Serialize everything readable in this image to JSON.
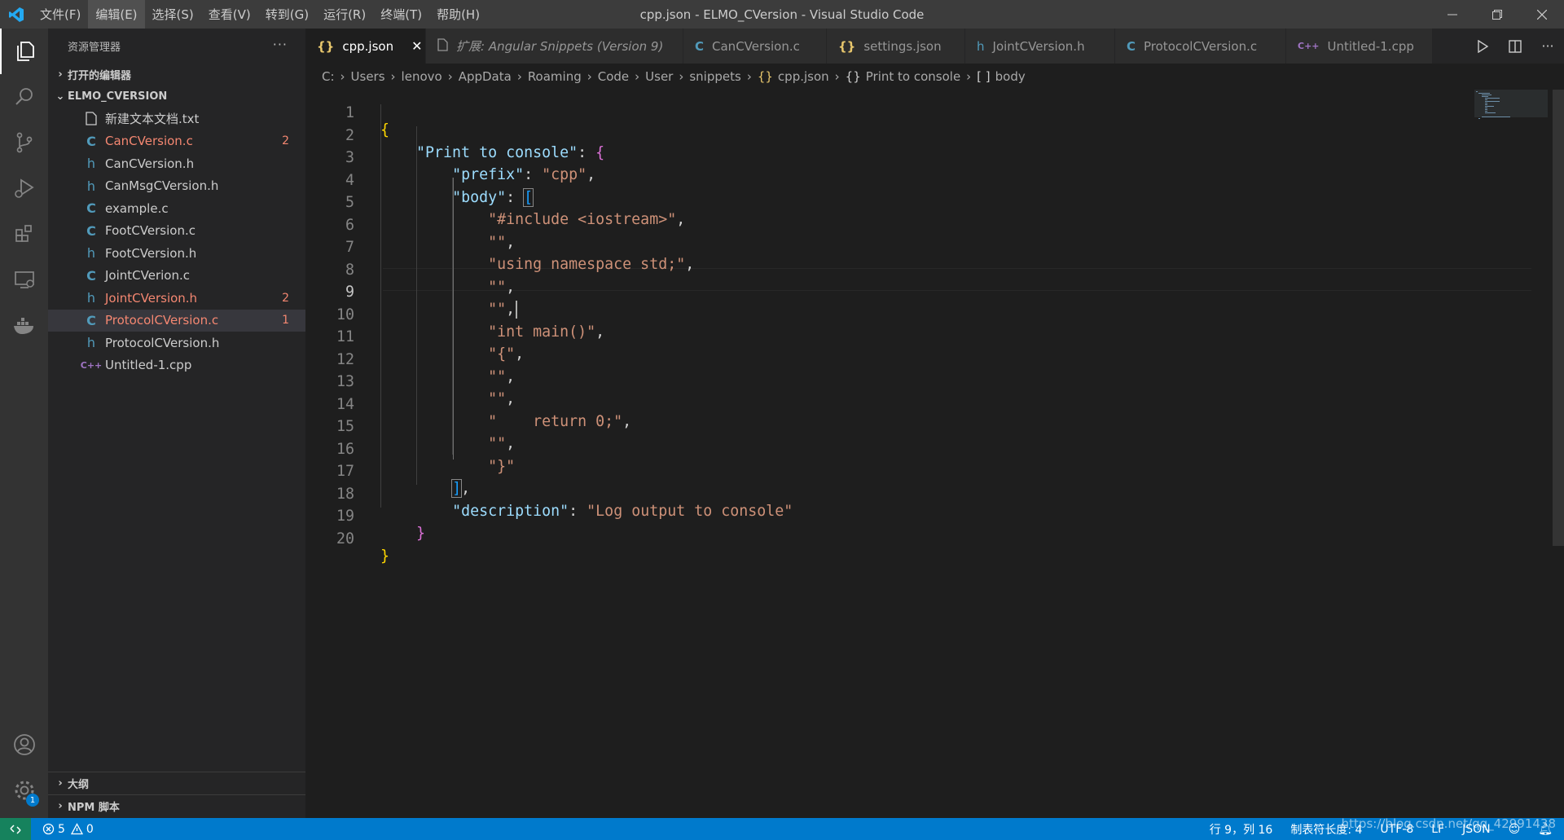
{
  "window": {
    "title": "cpp.json - ELMO_CVersion - Visual Studio Code",
    "menu": [
      "文件(F)",
      "编辑(E)",
      "选择(S)",
      "查看(V)",
      "转到(G)",
      "运行(R)",
      "终端(T)",
      "帮助(H)"
    ]
  },
  "sidebar": {
    "title": "资源管理器",
    "open_editors": "打开的编辑器",
    "folder": "ELMO_CVERSION",
    "files": [
      {
        "name": "新建文本文档.txt",
        "icon": "txt",
        "count": ""
      },
      {
        "name": "CanCVersion.c",
        "icon": "C",
        "count": "2"
      },
      {
        "name": "CanCVersion.h",
        "icon": "h",
        "count": ""
      },
      {
        "name": "CanMsgCVersion.h",
        "icon": "h",
        "count": ""
      },
      {
        "name": "example.c",
        "icon": "C",
        "count": ""
      },
      {
        "name": "FootCVersion.c",
        "icon": "C",
        "count": ""
      },
      {
        "name": "FootCVersion.h",
        "icon": "h",
        "count": ""
      },
      {
        "name": "JointCVerion.c",
        "icon": "C",
        "count": ""
      },
      {
        "name": "JointCVersion.h",
        "icon": "h",
        "count": "2"
      },
      {
        "name": "ProtocolCVersion.c",
        "icon": "C",
        "count": "1"
      },
      {
        "name": "ProtocolCVersion.h",
        "icon": "h",
        "count": ""
      },
      {
        "name": "Untitled-1.cpp",
        "icon": "C++",
        "count": ""
      }
    ],
    "outline": "大纲",
    "npm": "NPM 脚本"
  },
  "tabs": [
    {
      "icon": "{}",
      "label": "cpp.json"
    },
    {
      "icon": "doc",
      "label": "扩展: Angular Snippets (Version 9)"
    },
    {
      "icon": "C",
      "label": "CanCVersion.c"
    },
    {
      "icon": "{}",
      "label": "settings.json"
    },
    {
      "icon": "h",
      "label": "JointCVersion.h"
    },
    {
      "icon": "C",
      "label": "ProtocolCVersion.c"
    },
    {
      "icon": "C++",
      "label": "Untitled-1.cpp"
    }
  ],
  "breadcrumb": {
    "path": [
      "C:",
      "Users",
      "lenovo",
      "AppData",
      "Roaming",
      "Code",
      "User",
      "snippets"
    ],
    "file": "cpp.json",
    "symbol1": "Print to console",
    "symbol2": "body",
    "symbol1_icon": "{}",
    "symbol2_icon": "[ ]"
  },
  "editor": {
    "line_numbers": [
      "1",
      "2",
      "3",
      "4",
      "5",
      "6",
      "7",
      "8",
      "9",
      "10",
      "11",
      "12",
      "13",
      "14",
      "15",
      "16",
      "17",
      "18",
      "19",
      "20"
    ],
    "t": {
      "open_brace": "{",
      "close_brace": "}",
      "key_print": "\"Print to console\"",
      "colon": ": ",
      "key_prefix": "\"prefix\"",
      "val_prefix": "\"cpp\"",
      "key_body": "\"body\"",
      "open_bracket": "[",
      "close_bracket": "]",
      "comma": ",",
      "l5": "\"#include <iostream>\"",
      "l6": "\"\"",
      "l7": "\"using namespace std;\"",
      "l8": "\"\"",
      "l9": "\"\"",
      "l10": "\"int main()\"",
      "l11": "\"{\"",
      "l12": "\"\"",
      "l13": "\"\"",
      "l14": "\"    return 0;\"",
      "l15": "\"\"",
      "l16": "\"}\"",
      "key_desc": "\"description\"",
      "val_desc": "\"Log output to console\""
    }
  },
  "statusbar": {
    "errors": "5",
    "warnings": "0",
    "cursor": "行 9，列 16",
    "indent": "制表符长度: 4",
    "encoding": "UTF-8",
    "eol": "LF",
    "language": "JSON",
    "watermark": "https://blog.csdn.net/qq_42991438"
  },
  "activity_badge": "1"
}
